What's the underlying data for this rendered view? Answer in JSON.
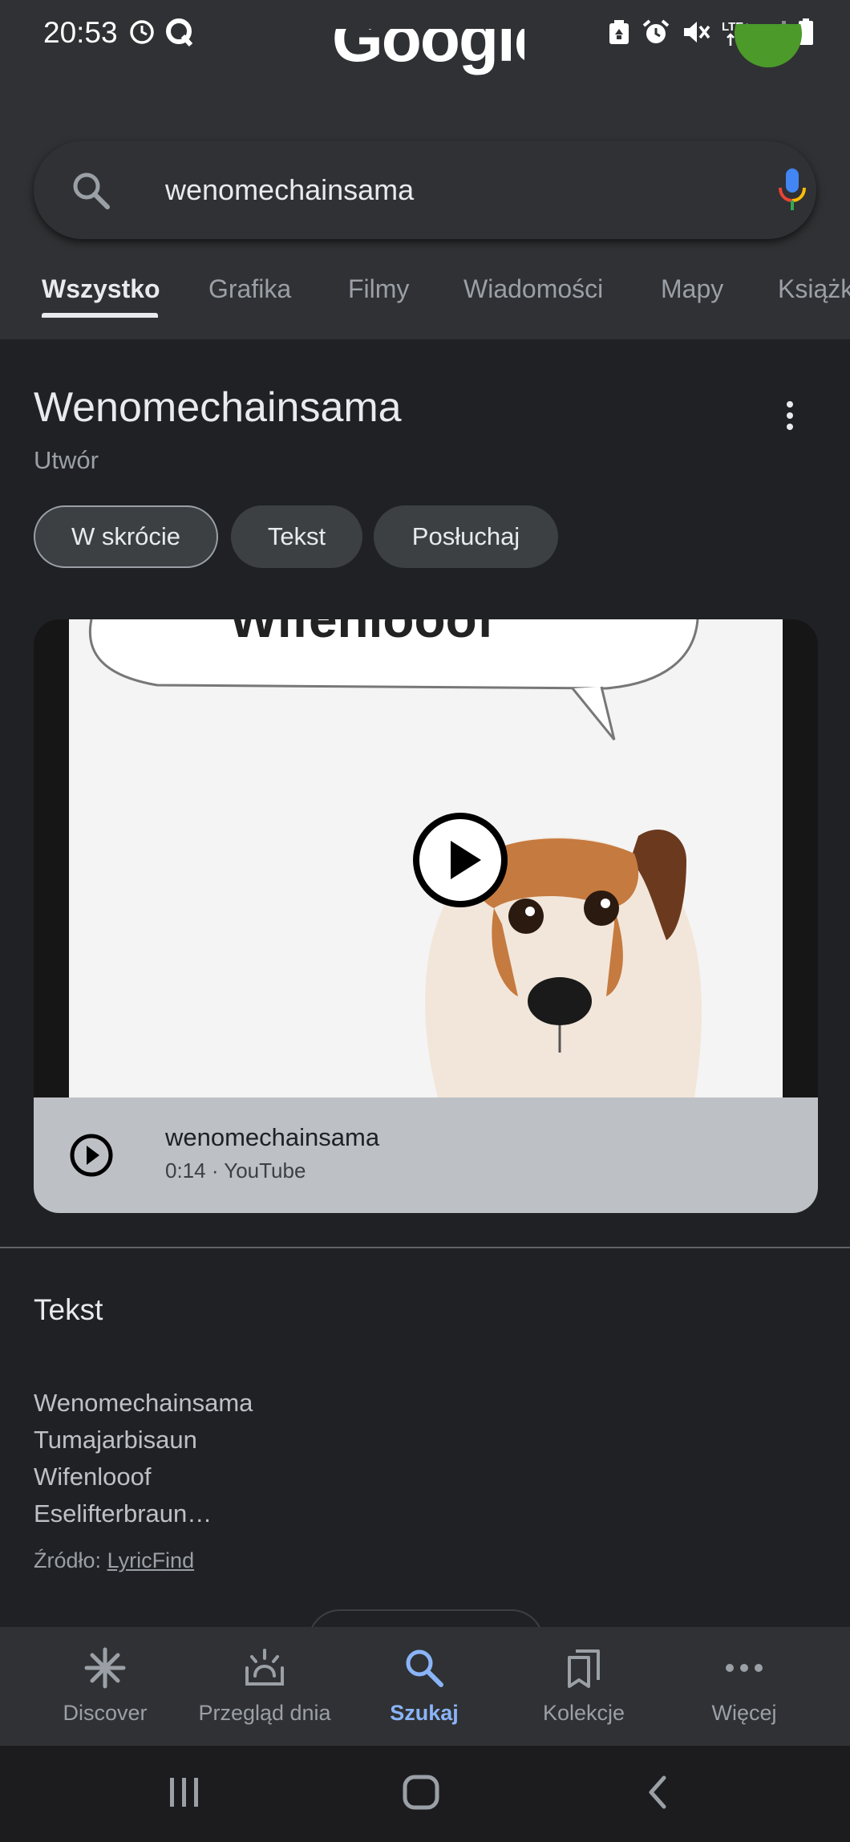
{
  "status_bar": {
    "time": "20:53",
    "left_icons": [
      "clock-status-icon",
      "q-app-icon"
    ],
    "right_icons": [
      "recycle-status-icon",
      "alarm-icon",
      "mute-icon",
      "lte-icon",
      "signal-icon",
      "battery-icon"
    ],
    "network_label": "LTE+"
  },
  "header": {
    "logo_text": "Google",
    "avatar_color": "#4c9a2a"
  },
  "search": {
    "query": "wenomechainsama"
  },
  "tabs": [
    {
      "label": "Wszystko",
      "active": true
    },
    {
      "label": "Grafika"
    },
    {
      "label": "Filmy"
    },
    {
      "label": "Wiadomości"
    },
    {
      "label": "Mapy"
    },
    {
      "label": "Książki"
    }
  ],
  "knowledge_panel": {
    "title": "Wenomechainsama",
    "subtitle": "Utwór",
    "chips": [
      {
        "label": "W skrócie",
        "selected": true
      },
      {
        "label": "Tekst"
      },
      {
        "label": "Posłuchaj"
      }
    ]
  },
  "video": {
    "thumbnail_caption": "Wifenlooof",
    "title": "wenomechainsama",
    "meta": "0:14 · YouTube"
  },
  "lyrics": {
    "heading": "Tekst",
    "lines": [
      "Wenomechainsama",
      "Tumajarbisaun",
      "Wifenlooof",
      "Eselifterbraun…"
    ],
    "source_prefix": "Źródło:",
    "source_link": "LyricFind"
  },
  "bottom_nav": [
    {
      "label": "Discover",
      "icon": "asterisk-icon"
    },
    {
      "label": "Przegląd dnia",
      "icon": "sunrise-icon"
    },
    {
      "label": "Szukaj",
      "icon": "search-icon",
      "active": true
    },
    {
      "label": "Kolekcje",
      "icon": "bookmarks-icon"
    },
    {
      "label": "Więcej",
      "icon": "more-dots-icon"
    }
  ],
  "colors": {
    "background": "#202124",
    "header": "#303134",
    "active_nav": "#8ab4f8",
    "video_info_bar": "#bdc1c6"
  }
}
